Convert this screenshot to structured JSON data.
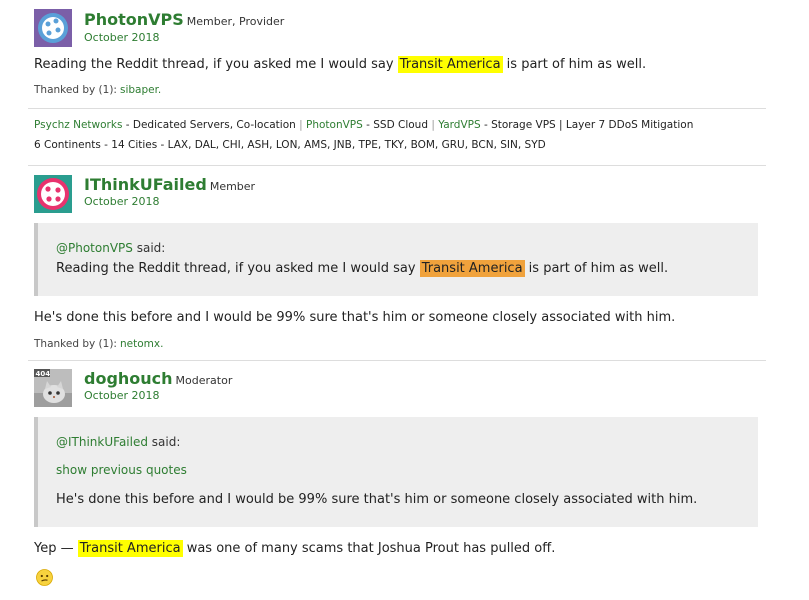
{
  "posts": [
    {
      "username": "PhotonVPS",
      "role": "Member, Provider",
      "date": "October 2018",
      "body_before": "Reading the Reddit thread, if you asked me I would say ",
      "body_highlight": "Transit America",
      "body_after": " is part of him as well.",
      "thanked_label": "Thanked by (1):",
      "thanked_users": "sibaper.",
      "signature": {
        "line1": [
          {
            "text": "Psychz Networks",
            "link": true
          },
          {
            "text": " - Dedicated Servers, Co-location ",
            "link": false
          },
          {
            "text": "|",
            "pipe": true
          },
          {
            "text": " PhotonVPS",
            "link": true
          },
          {
            "text": " - SSD Cloud ",
            "link": false
          },
          {
            "text": "|",
            "pipe": true
          },
          {
            "text": " YardVPS",
            "link": true
          },
          {
            "text": " - Storage VPS | Layer 7 DDoS Mitigation",
            "link": false
          }
        ],
        "line2": "6 Continents - 14 Cities - LAX, DAL, CHI, ASH, LON, AMS, JNB, TPE, TKY, BOM, GRU, BCN, SIN, SYD"
      }
    },
    {
      "username": "IThinkUFailed",
      "role": "Member",
      "date": "October 2018",
      "quote": {
        "author": "@PhotonVPS",
        "said": " said:",
        "text_before": "Reading the Reddit thread, if you asked me I would say ",
        "text_highlight": "Transit America",
        "text_after": " is part of him as well."
      },
      "body": "He's done this before and I would be 99% sure that's him or someone closely associated with him.",
      "thanked_label": "Thanked by (1):",
      "thanked_users": "netomx."
    },
    {
      "username": "doghouch",
      "role": "Moderator",
      "date": "October 2018",
      "avatar_badge": "404",
      "quote": {
        "author": "@IThinkUFailed",
        "said": " said:",
        "show_previous": "show previous quotes",
        "text": "He's done this before and I would be 99% sure that's him or someone closely associated with him."
      },
      "body_before": "Yep — ",
      "body_highlight": "Transit America",
      "body_after": " was one of many scams that Joshua Prout has pulled off.",
      "emoji": "confused-face"
    }
  ],
  "colors": {
    "link": "#2e7d32",
    "highlight_yellow": "#ffff00",
    "highlight_orange": "#f0a23c",
    "quote_bg": "#eeeeee"
  }
}
